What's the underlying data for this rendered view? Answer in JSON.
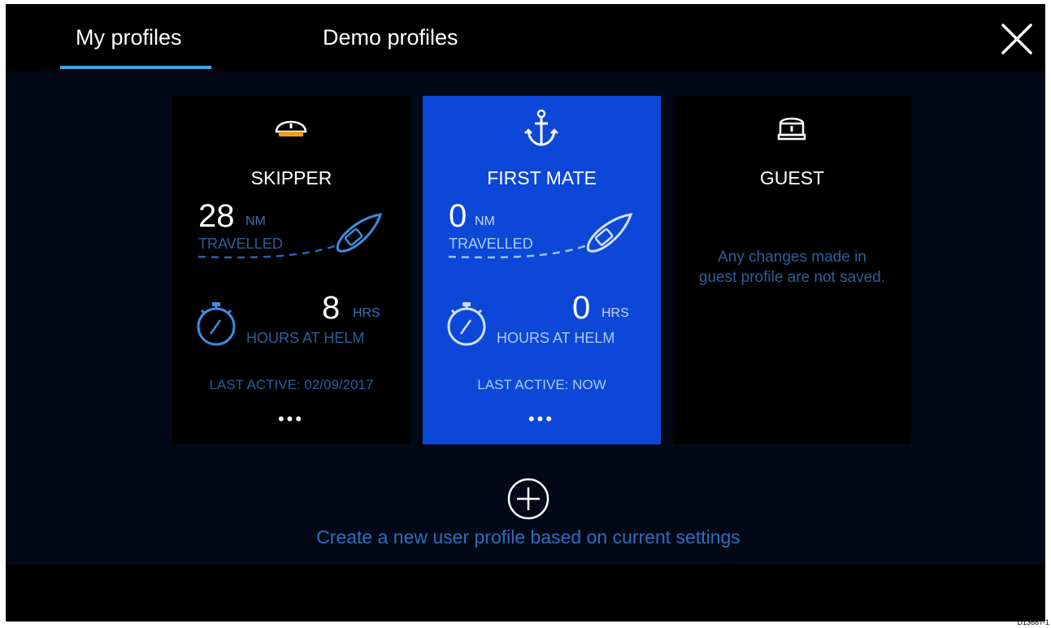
{
  "tabs": [
    {
      "label": "My profiles",
      "active": true
    },
    {
      "label": "Demo profiles",
      "active": false
    }
  ],
  "close_icon": "close-icon",
  "profiles": [
    {
      "name": "SKIPPER",
      "icon": "captain-hat-icon",
      "distance_value": "28",
      "distance_unit": "NM",
      "distance_label": "TRAVELLED",
      "hours_value": "8",
      "hours_unit": "HRS",
      "hours_label": "HOURS AT HELM",
      "last_active": "LAST ACTIVE: 02/09/2017",
      "more": "•••",
      "selected": false
    },
    {
      "name": "FIRST MATE",
      "icon": "anchor-icon",
      "distance_value": "0",
      "distance_unit": "NM",
      "distance_label": "TRAVELLED",
      "hours_value": "0",
      "hours_unit": "HRS",
      "hours_label": "HOURS AT HELM",
      "last_active": "LAST ACTIVE: NOW",
      "more": "•••",
      "selected": true
    },
    {
      "name": "GUEST",
      "icon": "guest-hat-icon",
      "note": "Any changes made in guest profile are not saved.",
      "selected": false
    }
  ],
  "create_profile": {
    "icon": "add-circle-icon",
    "label": "Create a new user profile based on current settings"
  },
  "reference_code": "D13687-1",
  "colors": {
    "accent_underline": "#3fa8e8",
    "selected_card": "#0c47d8",
    "muted_blue_text": "#2c5f9c",
    "background": "#020815"
  }
}
